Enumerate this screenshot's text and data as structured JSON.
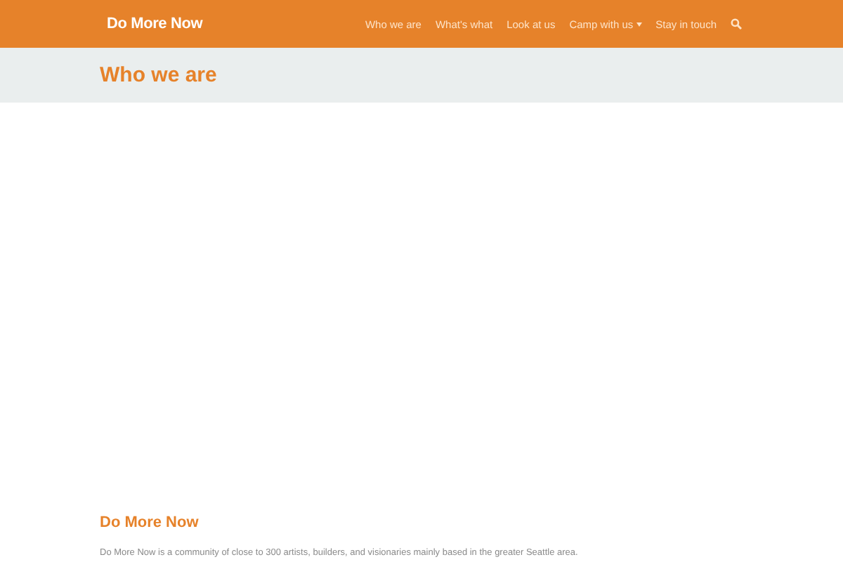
{
  "header": {
    "logo": "Do More Now",
    "nav": [
      {
        "label": "Who we are",
        "dropdown": false
      },
      {
        "label": "What's what",
        "dropdown": false
      },
      {
        "label": "Look at us",
        "dropdown": false
      },
      {
        "label": "Camp with us",
        "dropdown": true
      },
      {
        "label": "Stay in touch",
        "dropdown": false
      }
    ]
  },
  "page_title": "Who we are",
  "section": {
    "heading": "Do More Now",
    "text": "Do More Now is a community of close to 300 artists, builders, and visionaries mainly based in the greater Seattle area."
  }
}
